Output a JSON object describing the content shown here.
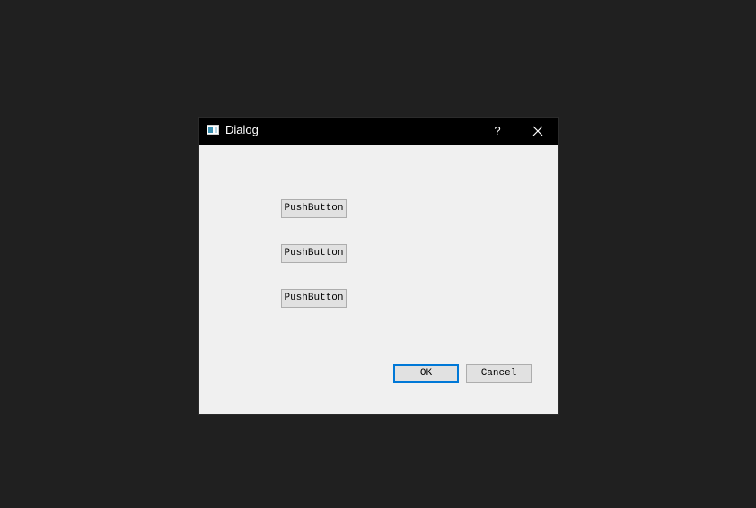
{
  "window": {
    "title": "Dialog",
    "help_label": "?",
    "icon": "app-window-icon",
    "close_icon": "close-icon"
  },
  "buttons": {
    "push_1": "PushButton",
    "push_2": "PushButton",
    "push_3": "PushButton",
    "ok": "OK",
    "cancel": "Cancel"
  },
  "colors": {
    "desktop": "#202020",
    "titlebar": "#000000",
    "dialog_bg": "#f0f0f0",
    "button_bg": "#e1e1e1",
    "focus_border": "#0078d7"
  }
}
